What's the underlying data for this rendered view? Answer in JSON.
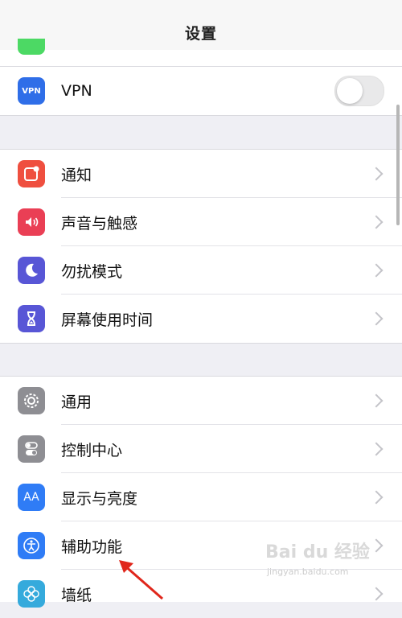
{
  "navbar": {
    "title": "设置"
  },
  "vpn": {
    "label": "VPN",
    "icon_text": "VPN",
    "toggle_on": false
  },
  "group1": [
    {
      "label": "通知",
      "icon": "notification-icon",
      "color": "#ef4f3f"
    },
    {
      "label": "声音与触感",
      "icon": "speaker-icon",
      "color": "#ea3f55"
    },
    {
      "label": "勿扰模式",
      "icon": "moon-icon",
      "color": "#5856d6"
    },
    {
      "label": "屏幕使用时间",
      "icon": "hourglass-icon",
      "color": "#5856d6"
    }
  ],
  "group2": [
    {
      "label": "通用",
      "icon": "gear-icon",
      "color": "#8e8e93"
    },
    {
      "label": "控制中心",
      "icon": "toggles-icon",
      "color": "#8e8e93"
    },
    {
      "label": "显示与亮度",
      "icon": "text-size-icon",
      "icon_text": "AA",
      "color": "#2f7cf6"
    },
    {
      "label": "辅助功能",
      "icon": "accessibility-icon",
      "color": "#2f7cf6"
    },
    {
      "label": "墙纸",
      "icon": "wallpaper-icon",
      "color": "#35aadc"
    }
  ],
  "watermark": {
    "main": "Bai du 经验",
    "sub": "jingyan.baidu.com"
  },
  "colors": {
    "background": "#efeff4",
    "chevron": "#c4c4c9",
    "accent_arrow": "#e0261b"
  }
}
